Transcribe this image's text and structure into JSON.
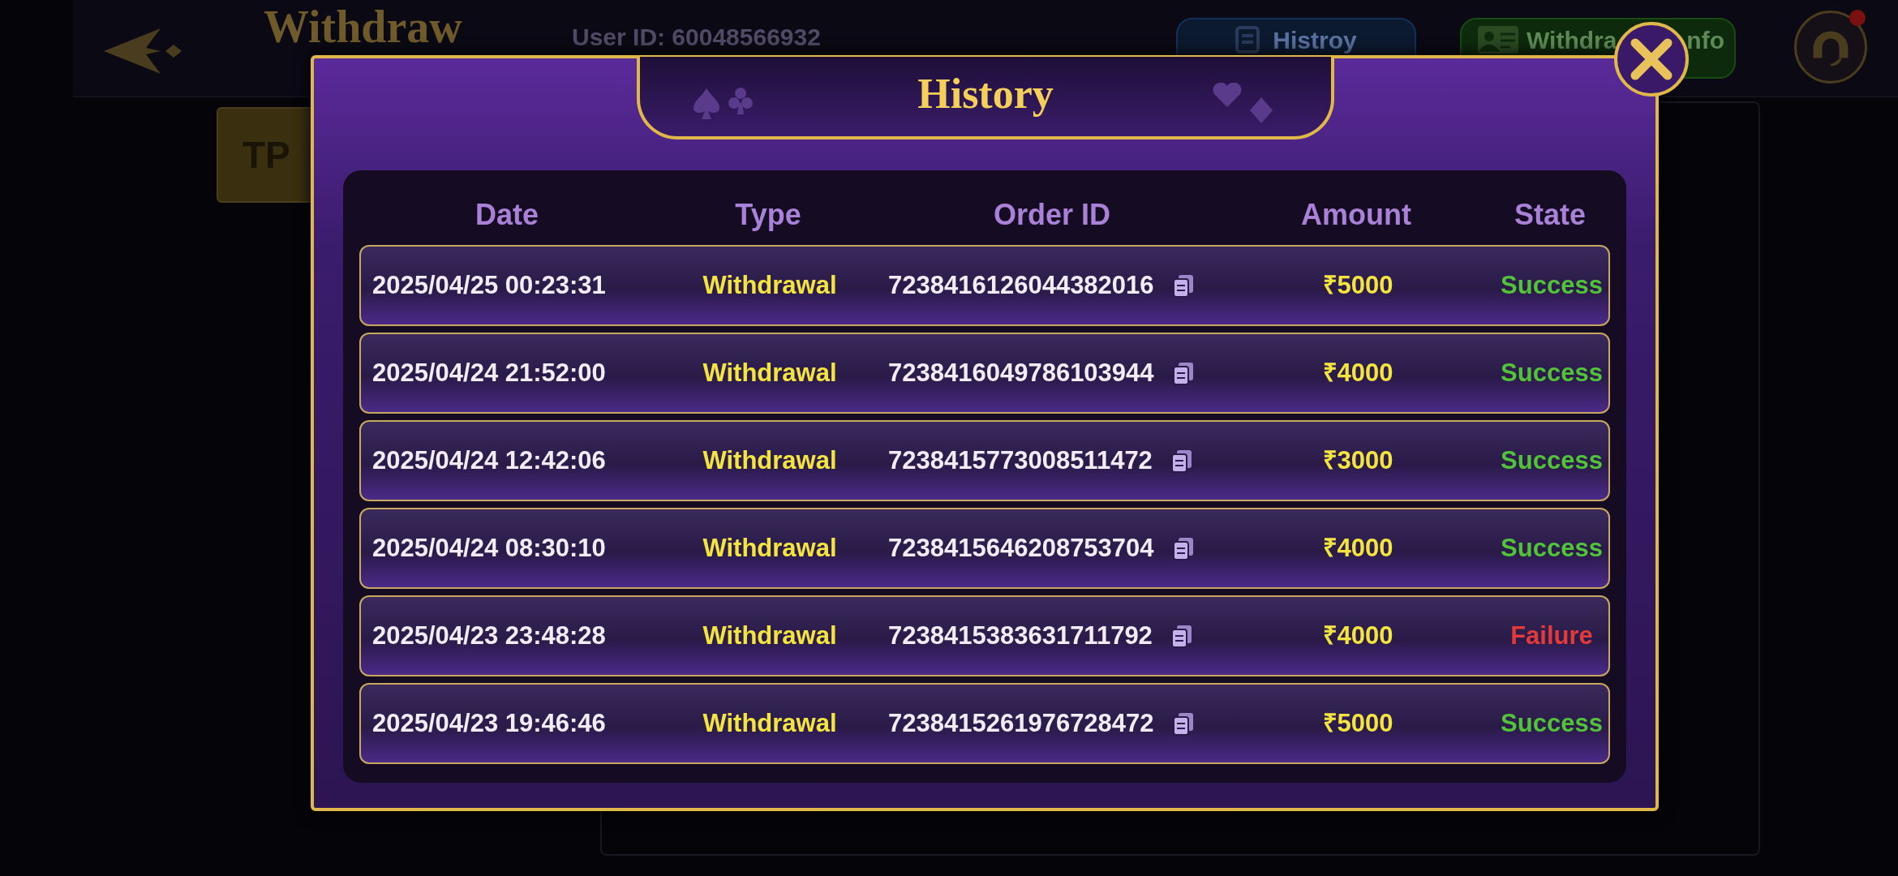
{
  "top_bar": {
    "title": "Withdraw",
    "user_id": "User ID: 60048566932",
    "tabs": [
      {
        "kind": "history",
        "label": "Histroy"
      },
      {
        "kind": "info",
        "label": "Withdra",
        "label_tail": "nfo"
      }
    ],
    "support_badge": true
  },
  "side_button": {
    "label": "TP"
  },
  "dialog": {
    "title": "History",
    "columns": [
      "Date",
      "Type",
      "Order ID",
      "Amount",
      "State"
    ],
    "rows": [
      {
        "date": "2025/04/25 00:23:31",
        "type": "Withdrawal",
        "order_id": "7238416126044382016",
        "amount": "₹5000",
        "state": "Success",
        "kind": "success"
      },
      {
        "date": "2025/04/24 21:52:00",
        "type": "Withdrawal",
        "order_id": "7238416049786103944",
        "amount": "₹4000",
        "state": "Success",
        "kind": "success"
      },
      {
        "date": "2025/04/24 12:42:06",
        "type": "Withdrawal",
        "order_id": "7238415773008511472",
        "amount": "₹3000",
        "state": "Success",
        "kind": "success"
      },
      {
        "date": "2025/04/24 08:30:10",
        "type": "Withdrawal",
        "order_id": "7238415646208753704",
        "amount": "₹4000",
        "state": "Success",
        "kind": "success"
      },
      {
        "date": "2025/04/23 23:48:28",
        "type": "Withdrawal",
        "order_id": "7238415383631711792",
        "amount": "₹4000",
        "state": "Failure",
        "kind": "failure"
      },
      {
        "date": "2025/04/23 19:46:46",
        "type": "Withdrawal",
        "order_id": "7238415261976728472",
        "amount": "₹5000",
        "state": "Success",
        "kind": "success"
      }
    ]
  }
}
